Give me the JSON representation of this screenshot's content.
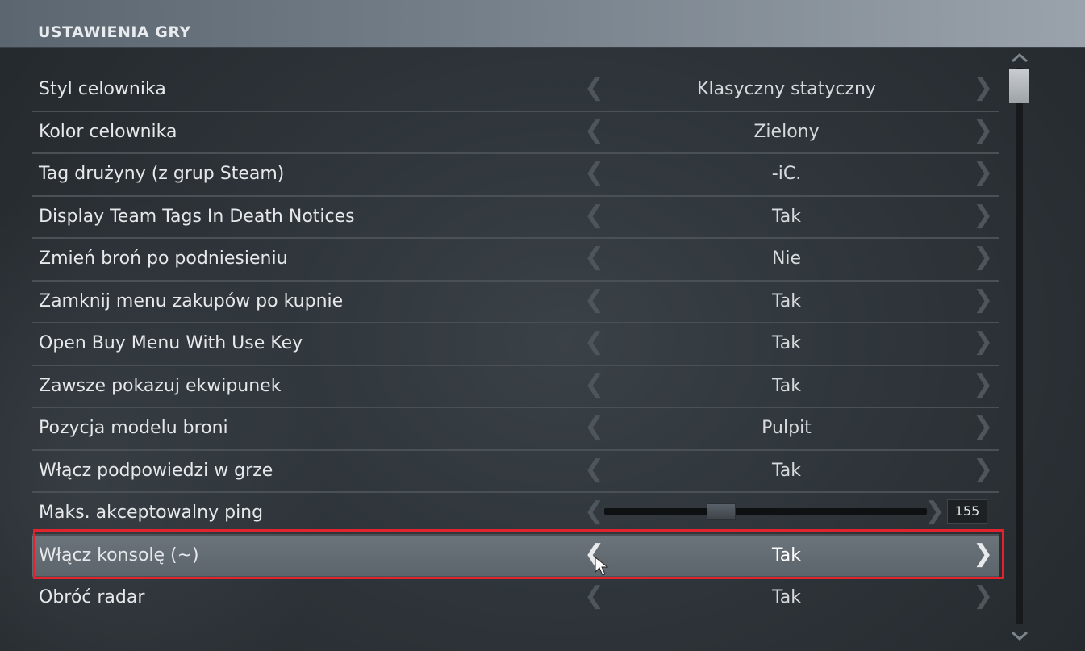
{
  "header": {
    "title": "USTAWIENIA GRY"
  },
  "arrows": {
    "left": "❮",
    "right": "❯"
  },
  "settings": [
    {
      "label": "Styl celownika",
      "value": "Klasyczny statyczny"
    },
    {
      "label": "Kolor celownika",
      "value": "Zielony"
    },
    {
      "label": "Tag drużyny (z grup Steam)",
      "value": "-iC."
    },
    {
      "label": "Display Team Tags In Death Notices",
      "value": "Tak"
    },
    {
      "label": "Zmień broń po podniesieniu",
      "value": "Nie"
    },
    {
      "label": "Zamknij menu zakupów po kupnie",
      "value": "Tak"
    },
    {
      "label": "Open Buy Menu With Use Key",
      "value": "Tak"
    },
    {
      "label": "Zawsze pokazuj ekwipunek",
      "value": "Tak"
    },
    {
      "label": "Pozycja modelu broni",
      "value": "Pulpit"
    },
    {
      "label": "Włącz podpowiedzi w grze",
      "value": "Tak"
    },
    {
      "label": "Maks. akceptowalny ping",
      "slider_value": "155",
      "slider_fraction": 0.35
    },
    {
      "label": "Włącz konsolę (~)",
      "value": "Tak",
      "selected": true
    },
    {
      "label": "Obróć radar",
      "value": "Tak"
    }
  ],
  "colors": {
    "highlight_border": "#e1232e",
    "selected_row": "#626a72",
    "header_gradient_end": "#9aa3ab"
  },
  "icons": {
    "cursor": "mouse-pointer-icon",
    "scroll_up": "chevron-up-icon",
    "scroll_down": "chevron-down-icon"
  }
}
